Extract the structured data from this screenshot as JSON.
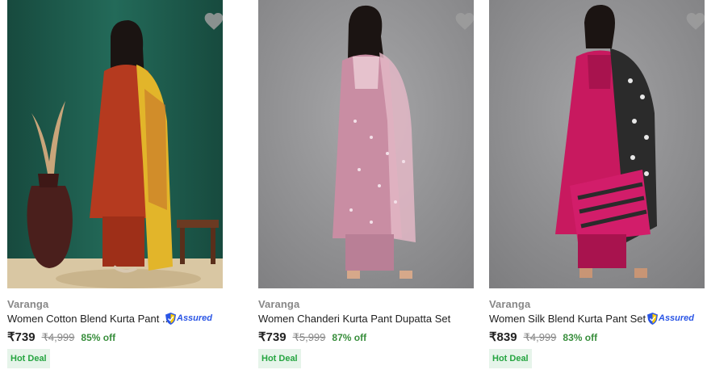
{
  "products": [
    {
      "brand": "Varanga",
      "title": "Women Cotton Blend Kurta Pant ...",
      "assured": "Assured",
      "price": "₹739",
      "mrp": "₹4,999",
      "discount": "85% off",
      "badge": "Hot Deal",
      "colors": {
        "bg": "#1e5a4c",
        "kurta": "#b53a1f",
        "dupatta": "#e2b52a"
      }
    },
    {
      "brand": "Varanga",
      "title": "Women Chanderi Kurta Pant Dupatta Set",
      "price": "₹739",
      "mrp": "₹5,999",
      "discount": "87% off",
      "badge": "Hot Deal",
      "colors": {
        "bg": "#8f8f91",
        "kurta": "#c98da3",
        "dupatta": "#e3b7c6"
      }
    },
    {
      "brand": "Varanga",
      "title": "Women Silk Blend Kurta Pant Set",
      "assured": "Assured",
      "price": "₹839",
      "mrp": "₹4,999",
      "discount": "83% off",
      "badge": "Hot Deal",
      "colors": {
        "bg": "#8c8c8e",
        "kurta": "#c8195f",
        "dupatta": "#2b2b2b"
      }
    }
  ]
}
